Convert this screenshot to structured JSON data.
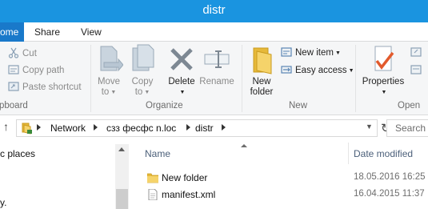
{
  "window": {
    "title": "distr"
  },
  "tabs": [
    {
      "label": "ome"
    },
    {
      "label": "Share"
    },
    {
      "label": "View"
    }
  ],
  "ribbon": {
    "clipboard": {
      "label": "pboard",
      "cut": "Cut",
      "copy_path": "Copy path",
      "paste_shortcut": "Paste shortcut"
    },
    "organize": {
      "label": "Organize",
      "move_to_line1": "Move",
      "move_to_line2": "to",
      "copy_to_line1": "Copy",
      "copy_to_line2": "to",
      "delete": "Delete",
      "rename": "Rename"
    },
    "new": {
      "label": "New",
      "new_folder_line1": "New",
      "new_folder_line2": "folder",
      "new_item": "New item",
      "easy_access": "Easy access"
    },
    "open": {
      "label": "Open",
      "properties": "Properties"
    }
  },
  "address_bar": {
    "crumbs": [
      "Network",
      " сзз фесфс n.loc",
      "distr"
    ]
  },
  "search": {
    "placeholder": "Search o"
  },
  "nav_pane": {
    "items": [
      "c places",
      "y."
    ]
  },
  "file_list": {
    "columns": {
      "name": "Name",
      "date_modified": "Date modified"
    },
    "rows": [
      {
        "name": "New folder",
        "date": "18.05.2016 16:25",
        "icon": "folder-icon"
      },
      {
        "name": "manifest.xml",
        "date": "16.04.2015 11:37",
        "icon": "xml-file-icon"
      }
    ]
  },
  "colors": {
    "titlebar": "#1a94e0",
    "active_tab": "#1979ca",
    "ribbon_bg": "#f5f6f7",
    "header_text": "#4c607a"
  }
}
